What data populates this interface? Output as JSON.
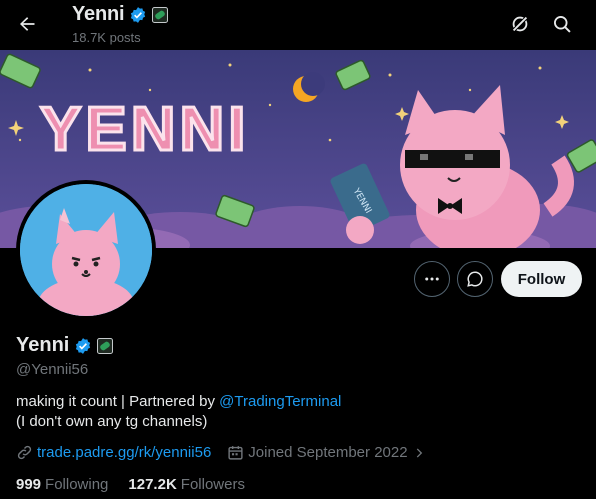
{
  "topbar": {
    "name": "Yenni",
    "posts": "18.7K posts"
  },
  "banner": {
    "title_text": "YENNI",
    "card_text": "YENNI"
  },
  "actions": {
    "follow_label": "Follow"
  },
  "profile": {
    "name": "Yenni",
    "handle": "@Yennii56",
    "bio_line1_prefix": "making it count | Partnered by ",
    "bio_mention": "@TradingTerminal",
    "bio_line2": "(I don't own any tg channels)",
    "website": "trade.padre.gg/rk/yennii56",
    "joined": "Joined September 2022"
  },
  "stats": {
    "following_count": "999",
    "following_label": "Following",
    "followers_count": "127.2K",
    "followers_label": "Followers"
  },
  "colors": {
    "accent": "#1d9bf0",
    "verified": "#1d9bf0",
    "affiliate_green": "#2e9e5a",
    "banner_bg": "#4b4a8c",
    "avatar_bg": "#4fb0e6",
    "pink": "#ee8fb0"
  },
  "icons": {
    "back": "arrow-left-icon",
    "grok": "grok-icon",
    "search": "search-icon",
    "more": "more-icon",
    "message": "message-icon",
    "link": "link-icon",
    "calendar": "calendar-icon",
    "chevron": "chevron-right-icon",
    "verified": "verified-badge-icon",
    "affiliate": "affiliate-badge-icon"
  }
}
